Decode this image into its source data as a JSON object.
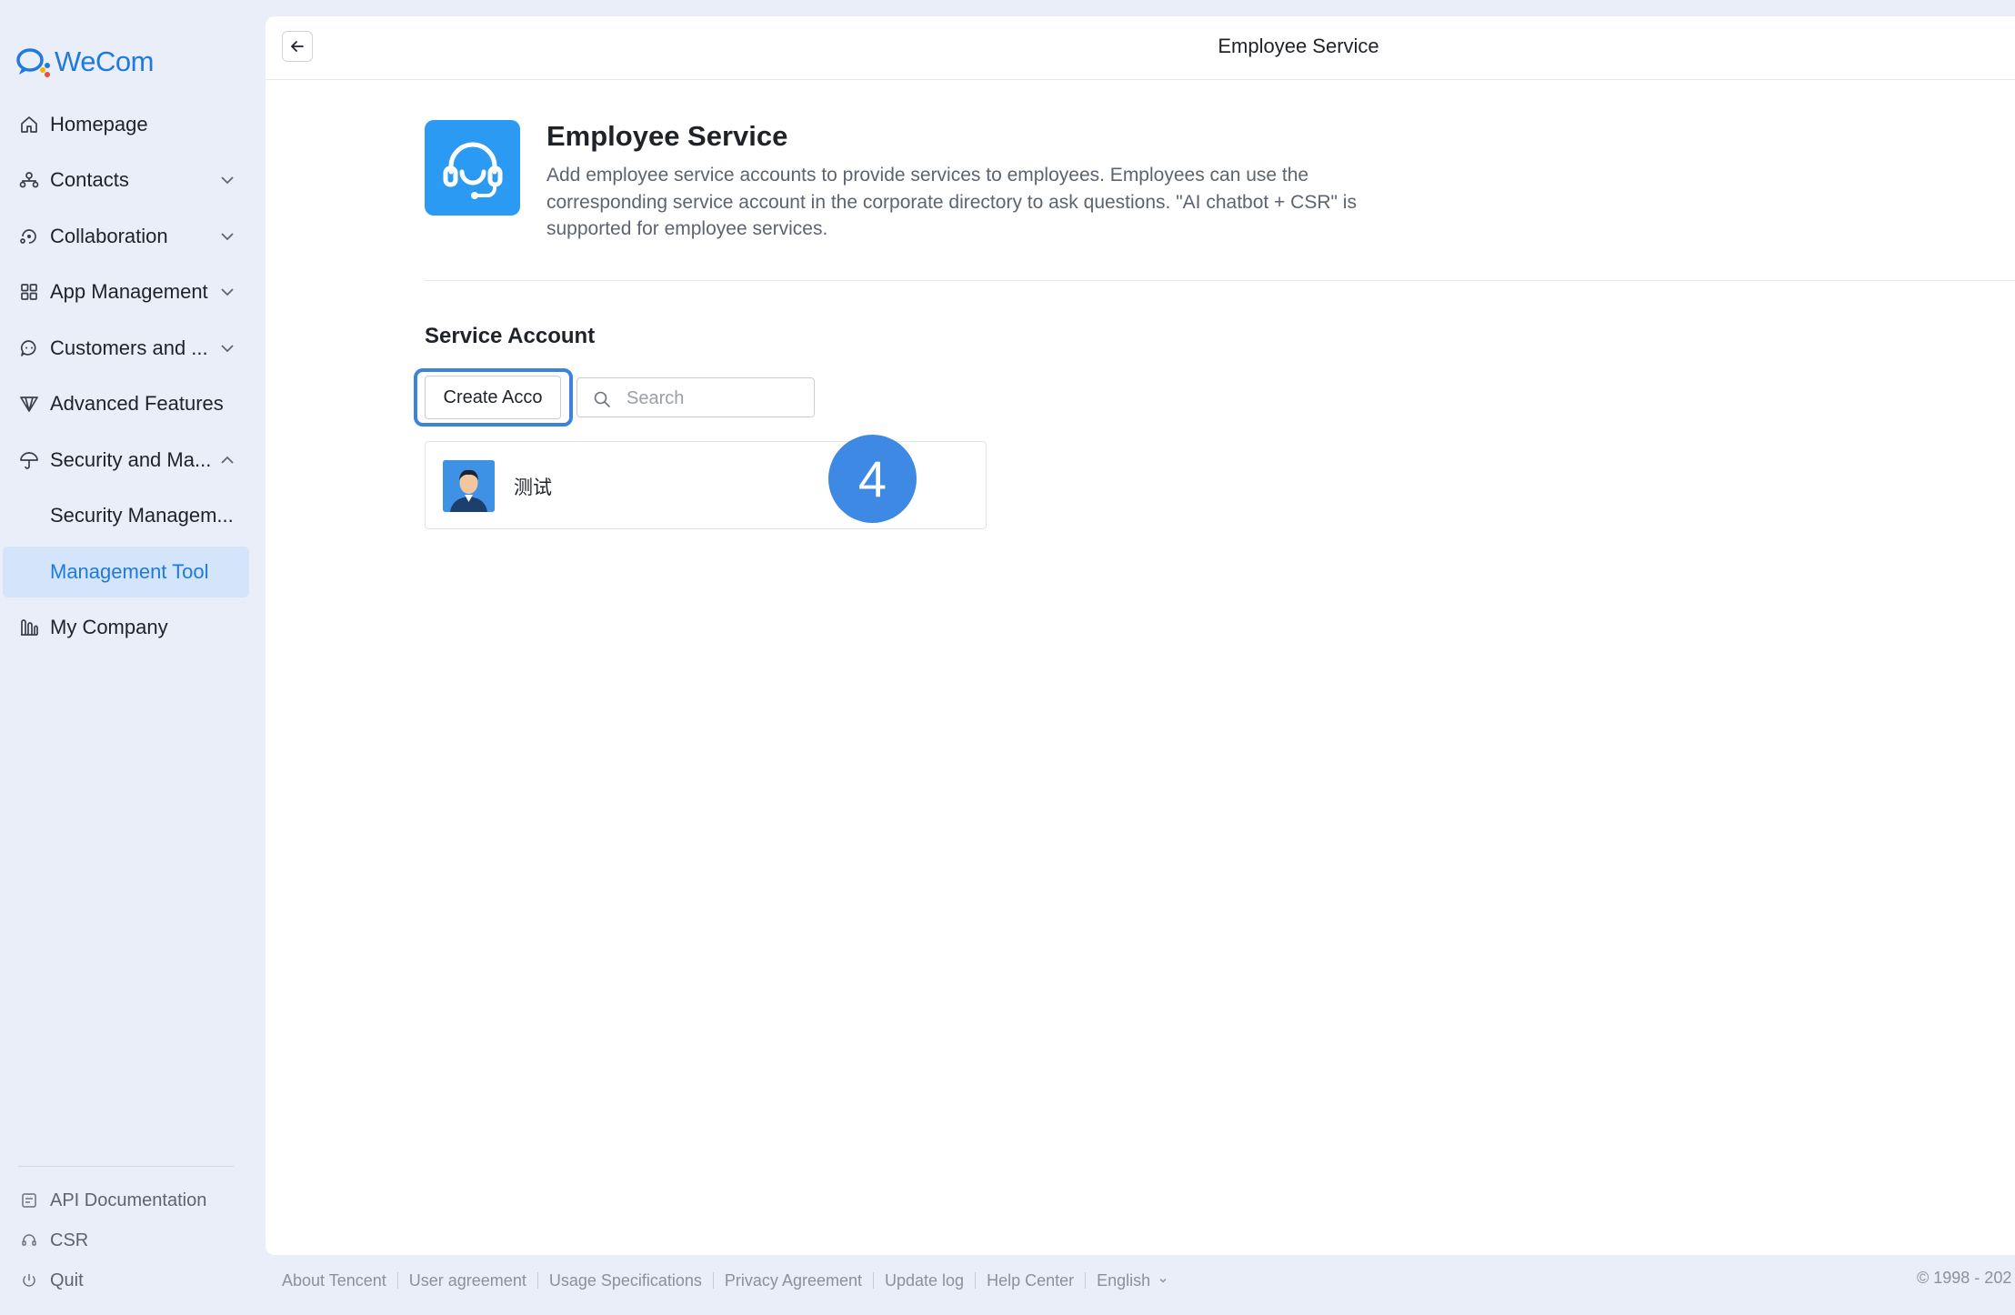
{
  "app": {
    "name": "WeCom"
  },
  "sidebar": {
    "items": [
      {
        "label": "Homepage",
        "icon": "home-icon"
      },
      {
        "label": "Contacts",
        "icon": "org-chart-icon",
        "chevron": "down"
      },
      {
        "label": "Collaboration",
        "icon": "collaboration-icon",
        "chevron": "down"
      },
      {
        "label": "App Management",
        "icon": "grid-icon",
        "chevron": "down"
      },
      {
        "label": "Customers and ...",
        "icon": "chat-bubble-icon",
        "chevron": "down"
      },
      {
        "label": "Advanced Features",
        "icon": "diamond-icon"
      },
      {
        "label": "Security and Ma...",
        "icon": "umbrella-icon",
        "chevron": "up"
      },
      {
        "label": "Security Managem..."
      },
      {
        "label": "Management Tool",
        "active": true
      },
      {
        "label": "My Company",
        "icon": "building-icon"
      }
    ],
    "bottom": [
      {
        "label": "API Documentation",
        "icon": "api-doc-icon"
      },
      {
        "label": "CSR",
        "icon": "headset-icon"
      },
      {
        "label": "Quit",
        "icon": "power-icon"
      }
    ]
  },
  "header": {
    "title": "Employee Service"
  },
  "hero": {
    "title": "Employee Service",
    "description": "Add employee service accounts to provide services to employees. Employees can use the corresponding service account in the corporate directory to ask questions. \"AI chatbot + CSR\" is supported for employee services."
  },
  "service_account": {
    "title": "Service Account",
    "create_label": "Create Acco",
    "search_placeholder": "Search",
    "accounts": [
      {
        "name": "测试"
      }
    ]
  },
  "step_badge": "4",
  "footer": {
    "links": [
      "About Tencent",
      "User agreement",
      "Usage Specifications",
      "Privacy Agreement",
      "Update log",
      "Help Center",
      "English"
    ],
    "copyright": "© 1998 - 202"
  },
  "colors": {
    "accent": "#1f7ae0",
    "active_bg": "#d3e4fb",
    "badge": "#3d89e3",
    "hero_icon": "#2b9af3"
  }
}
